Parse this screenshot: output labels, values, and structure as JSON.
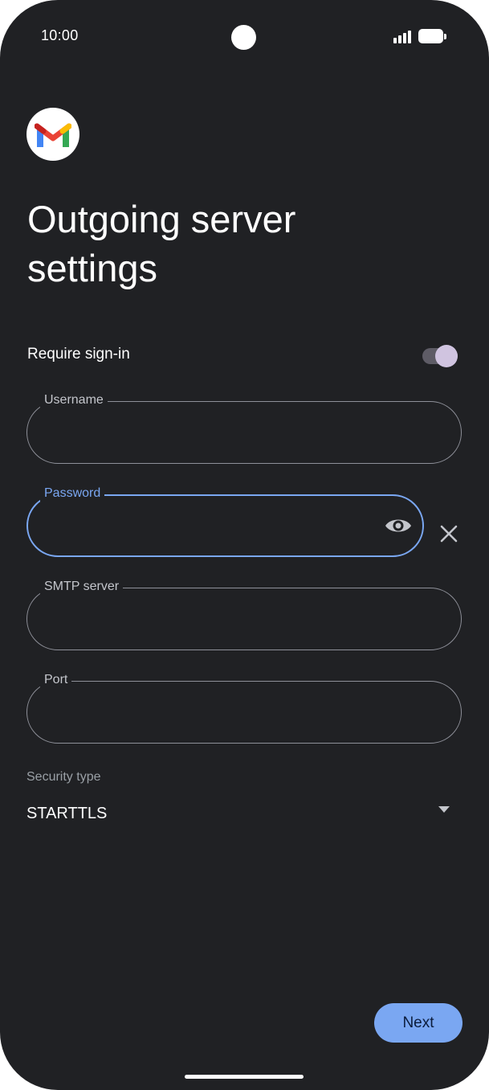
{
  "status_bar": {
    "time": "10:00",
    "icons": [
      "signal-icon",
      "battery-icon"
    ]
  },
  "app": {
    "logo": "gmail-logo-icon"
  },
  "header": {
    "title_line1": "Outgoing server",
    "title_line2": "settings"
  },
  "require_signin": {
    "label": "Require sign-in",
    "enabled": true
  },
  "fields": {
    "username": {
      "label": "Username",
      "value": ""
    },
    "password": {
      "label": "Password",
      "value": "",
      "focused": true
    },
    "smtp_server": {
      "label": "SMTP server",
      "value": ""
    },
    "port": {
      "label": "Port",
      "value": ""
    }
  },
  "security": {
    "label": "Security type",
    "value": "STARTTLS"
  },
  "actions": {
    "next_label": "Next"
  },
  "colors": {
    "background": "#202124",
    "accent": "#7aa7f2",
    "toggle_thumb": "#d0c4e0",
    "outline": "#8e9099"
  }
}
